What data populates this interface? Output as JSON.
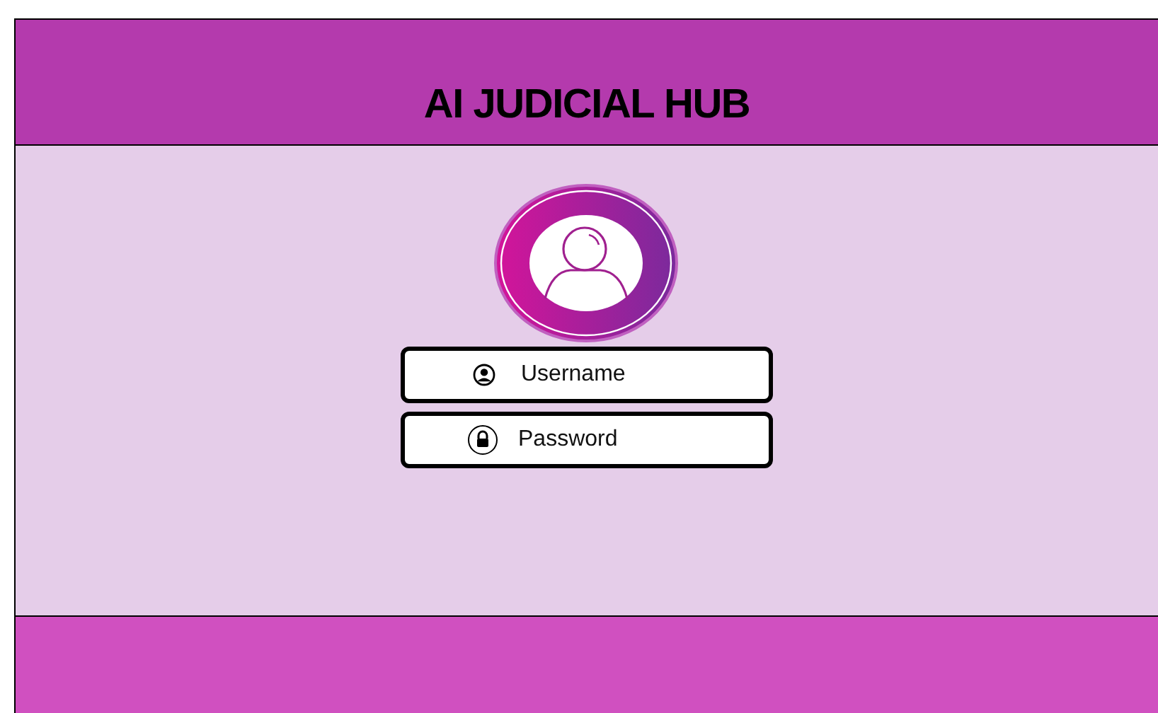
{
  "header": {
    "title": "AI JUDICIAL HUB"
  },
  "login_form": {
    "fields": [
      {
        "kind": "username",
        "placeholder": "Username"
      },
      {
        "kind": "password",
        "placeholder": "Password"
      }
    ]
  }
}
